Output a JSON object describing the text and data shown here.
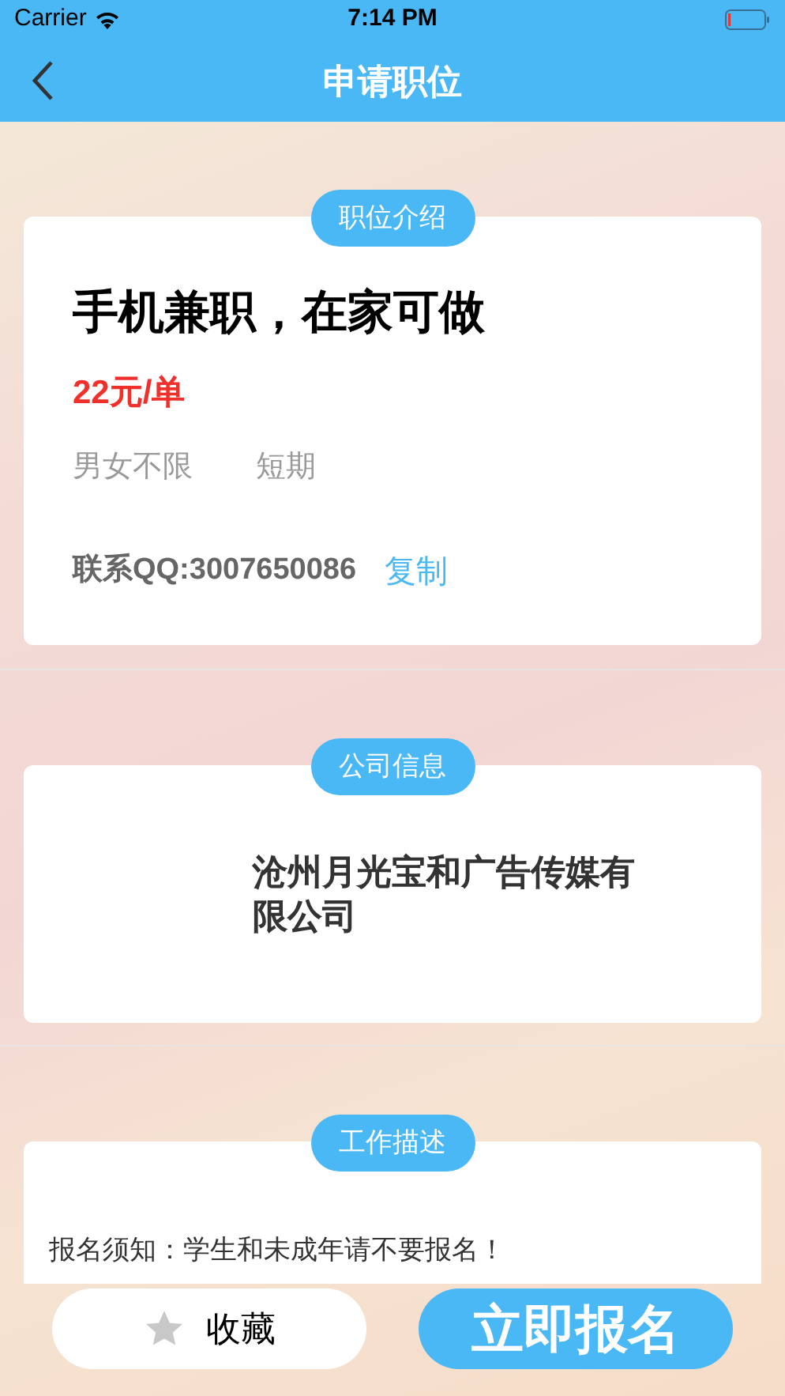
{
  "status_bar": {
    "carrier": "Carrier",
    "time": "7:14 PM"
  },
  "nav": {
    "title": "申请职位"
  },
  "job": {
    "badge": "职位介绍",
    "title": "手机兼职，在家可做",
    "pay": "22元/单",
    "tags": [
      "男女不限",
      "短期"
    ],
    "contact": "联系QQ:3007650086",
    "copy": "复制"
  },
  "company": {
    "badge": "公司信息",
    "name": "沧州月光宝和广告传媒有限公司"
  },
  "description": {
    "badge": "工作描述",
    "text": "报名须知：学生和未成年请不要报名！"
  },
  "actions": {
    "favorite": {
      "label": "收藏",
      "selected": false
    },
    "apply": "立即报名"
  }
}
